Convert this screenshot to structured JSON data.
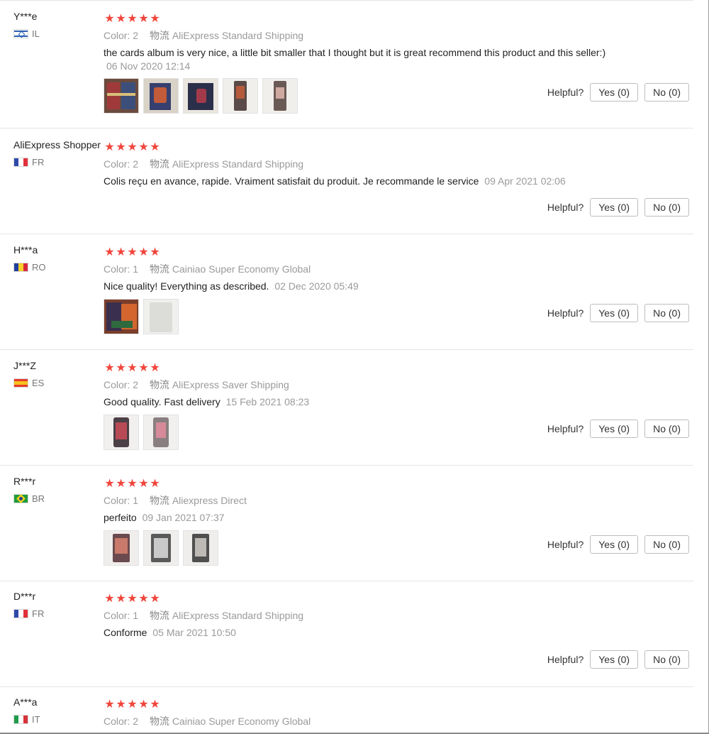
{
  "reviews": [
    {
      "user": "Y***e",
      "country": "IL",
      "flag": "il",
      "stars": [
        "★",
        "★",
        "★",
        "★",
        "★"
      ],
      "color_label": "Color:",
      "color_value": "2",
      "shipping_label": "物流",
      "shipping": "AliExpress Standard Shipping",
      "text": "the cards album is very nice, a little bit smaller that I thought but it is great recommend this product and this seller:)",
      "date": "06 Nov 2020 12:14",
      "photo_count": 5,
      "helpful_label": "Helpful?",
      "yes_label": "Yes (0)",
      "no_label": "No (0)"
    },
    {
      "user": "AliExpress Shopper",
      "country": "FR",
      "flag": "fr",
      "stars": [
        "★",
        "★",
        "★",
        "★",
        "★"
      ],
      "color_label": "Color:",
      "color_value": "2",
      "shipping_label": "物流",
      "shipping": "AliExpress Standard Shipping",
      "text": "Colis reçu en avance, rapide. Vraiment satisfait du produit. Je recommande le service",
      "date": "09 Apr 2021 02:06",
      "photo_count": 0,
      "helpful_label": "Helpful?",
      "yes_label": "Yes (0)",
      "no_label": "No (0)"
    },
    {
      "user": "H***a",
      "country": "RO",
      "flag": "ro",
      "stars": [
        "★",
        "★",
        "★",
        "★",
        "★"
      ],
      "color_label": "Color:",
      "color_value": "1",
      "shipping_label": "物流",
      "shipping": "Cainiao Super Economy Global",
      "text": "Nice quality! Everything as described.",
      "date": "02 Dec 2020 05:49",
      "photo_count": 2,
      "helpful_label": "Helpful?",
      "yes_label": "Yes (0)",
      "no_label": "No (0)"
    },
    {
      "user": "J***Z",
      "country": "ES",
      "flag": "es",
      "stars": [
        "★",
        "★",
        "★",
        "★",
        "★"
      ],
      "color_label": "Color:",
      "color_value": "2",
      "shipping_label": "物流",
      "shipping": "AliExpress Saver Shipping",
      "text": "Good quality. Fast delivery",
      "date": "15 Feb 2021 08:23",
      "photo_count": 2,
      "helpful_label": "Helpful?",
      "yes_label": "Yes (0)",
      "no_label": "No (0)"
    },
    {
      "user": "R***r",
      "country": "BR",
      "flag": "br",
      "stars": [
        "★",
        "★",
        "★",
        "★",
        "★"
      ],
      "color_label": "Color:",
      "color_value": "1",
      "shipping_label": "物流",
      "shipping": "Aliexpress Direct",
      "text": "perfeito",
      "date": "09 Jan 2021 07:37",
      "photo_count": 3,
      "helpful_label": "Helpful?",
      "yes_label": "Yes (0)",
      "no_label": "No (0)"
    },
    {
      "user": "D***r",
      "country": "FR",
      "flag": "fr",
      "stars": [
        "★",
        "★",
        "★",
        "★",
        "★"
      ],
      "color_label": "Color:",
      "color_value": "1",
      "shipping_label": "物流",
      "shipping": "AliExpress Standard Shipping",
      "text": "Conforme",
      "date": "05 Mar 2021 10:50",
      "photo_count": 0,
      "helpful_label": "Helpful?",
      "yes_label": "Yes (0)",
      "no_label": "No (0)"
    },
    {
      "user": "A***a",
      "country": "IT",
      "flag": "it",
      "stars": [
        "★",
        "★",
        "★",
        "★",
        "★"
      ],
      "color_label": "Color:",
      "color_value": "2",
      "shipping_label": "物流",
      "shipping": "Cainiao Super Economy Global",
      "text": "",
      "date": "",
      "photo_count": 0,
      "helpful_label": "",
      "yes_label": "",
      "no_label": ""
    }
  ],
  "colors": {
    "star": "#f0463c",
    "meta_text": "#9a9a9a",
    "body_text": "#222222",
    "separator": "#e6e6e6",
    "button_border": "#bdbdbd"
  }
}
